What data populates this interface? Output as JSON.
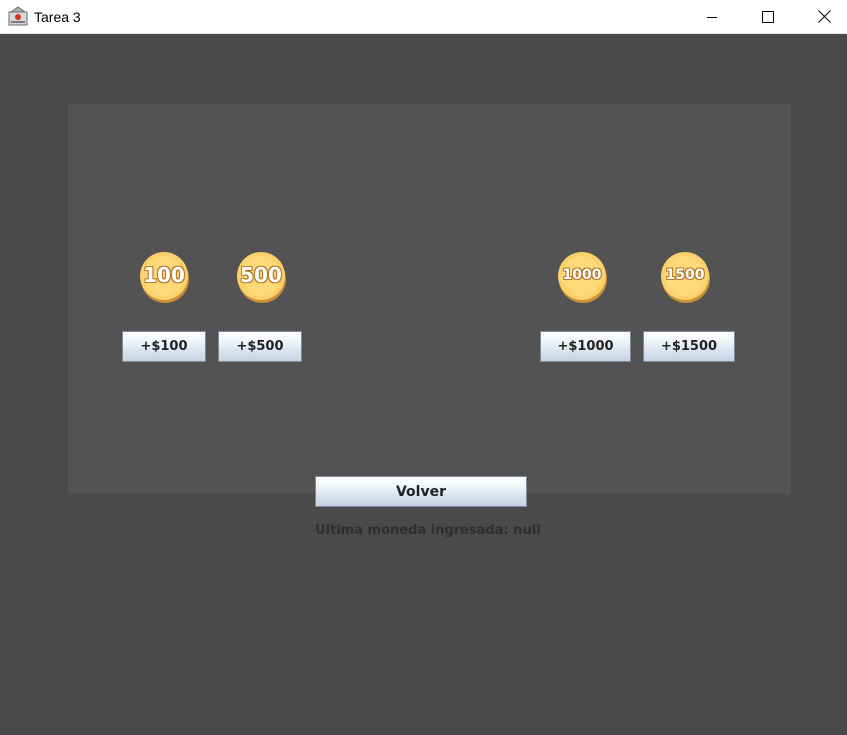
{
  "window": {
    "title": "Tarea 3",
    "controls": {
      "minimize": "minimize-icon",
      "maximize": "maximize-icon",
      "close": "close-icon"
    }
  },
  "coins": [
    {
      "label": "100",
      "button_label": "+$100"
    },
    {
      "label": "500",
      "button_label": "+$500"
    },
    {
      "label": "1000",
      "button_label": "+$1000"
    },
    {
      "label": "1500",
      "button_label": "+$1500"
    }
  ],
  "actions": {
    "back_label": "Volver"
  },
  "status": {
    "text": "Ultima moneda ingresada: null"
  },
  "colors": {
    "background": "#4a4a4a",
    "panel": "#535353",
    "coin_gold": "#fcd06a",
    "coin_rim": "#c9913a"
  }
}
